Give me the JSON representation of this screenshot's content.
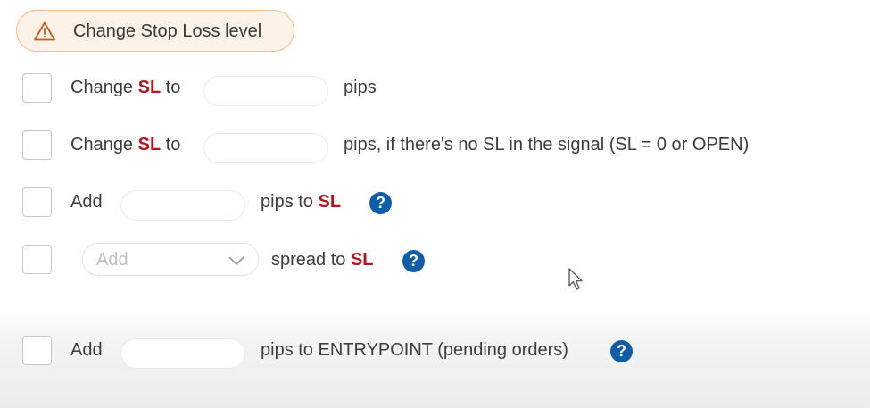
{
  "header": {
    "title": "Change Stop Loss level",
    "icon": "warning-triangle-icon",
    "accent": "#f2bd8c"
  },
  "colors": {
    "sl_red": "#b81420",
    "help_blue": "#0d5da8"
  },
  "rows": [
    {
      "prefix": "Change",
      "sl": "SL",
      "mid": "to",
      "input_value": "",
      "suffix": "pips"
    },
    {
      "prefix": "Change",
      "sl": "SL",
      "mid": "to",
      "input_value": "",
      "suffix": "pips, if there's no SL in the signal (SL = 0 or OPEN)"
    },
    {
      "prefix": "Add",
      "input_value": "",
      "suffix_text": "pips to",
      "sl": "SL"
    },
    {
      "select_value": "Add",
      "suffix_text": "spread to",
      "sl": "SL"
    },
    {
      "prefix": "Add",
      "input_value": "",
      "suffix": "pips to ENTRYPOINT (pending orders)"
    }
  ],
  "help_glyph": "?"
}
